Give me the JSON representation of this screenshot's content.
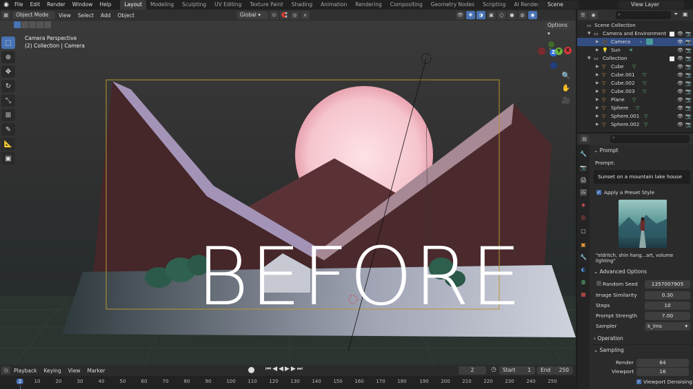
{
  "menubar": {
    "menus": [
      "File",
      "Edit",
      "Render",
      "Window",
      "Help"
    ],
    "workspaces": [
      "Layout",
      "Modeling",
      "Sculpting",
      "UV Editing",
      "Texture Paint",
      "Shading",
      "Animation",
      "Rendering",
      "Compositing",
      "Geometry Nodes",
      "Scripting",
      "AI Render"
    ],
    "active_workspace": "Layout",
    "add_tab": "+",
    "scene": "Scene",
    "view_layer": "View Layer"
  },
  "viewport_header": {
    "mode": "Object Mode",
    "menus": [
      "View",
      "Select",
      "Add",
      "Object"
    ],
    "transform": "Global",
    "options": "Options"
  },
  "viewport": {
    "caption_line1": "Camera Perspective",
    "caption_line2": "(2) Collection | Camera",
    "overlay_text": "BEFORE",
    "gizmo": {
      "z": "Z",
      "y": "Y",
      "x": "X"
    }
  },
  "timeline": {
    "menus": [
      "Playback",
      "Keying",
      "View",
      "Marker"
    ],
    "current_frame": "2",
    "start_label": "Start",
    "start": "1",
    "end_label": "End",
    "end": "250",
    "ticks": [
      "2",
      "10",
      "20",
      "30",
      "40",
      "50",
      "60",
      "70",
      "80",
      "90",
      "100",
      "110",
      "120",
      "130",
      "140",
      "150",
      "160",
      "170",
      "180",
      "190",
      "200",
      "210",
      "220",
      "230",
      "240",
      "250"
    ]
  },
  "outliner": {
    "root": "Scene Collection",
    "items": [
      {
        "label": "Camera and Environment",
        "type": "collection"
      },
      {
        "label": "Camera",
        "type": "camera",
        "selected": true
      },
      {
        "label": "Sun",
        "type": "light"
      },
      {
        "label": "Collection",
        "type": "collection"
      },
      {
        "label": "Cube",
        "type": "mesh"
      },
      {
        "label": "Cube.001",
        "type": "mesh"
      },
      {
        "label": "Cube.002",
        "type": "mesh"
      },
      {
        "label": "Cube.003",
        "type": "mesh"
      },
      {
        "label": "Plane",
        "type": "mesh"
      },
      {
        "label": "Sphere",
        "type": "mesh"
      },
      {
        "label": "Sphere.001",
        "type": "mesh"
      },
      {
        "label": "Sphere.002",
        "type": "mesh"
      }
    ]
  },
  "properties": {
    "prompt_panel": "Prompt",
    "prompt_label": "Prompt:",
    "prompt_value": "Sunset on a mountain lake house",
    "preset_checkbox": "Apply a Preset Style",
    "preset_caption": "\"eldritch, shin hang...art, volume lighting\"",
    "advanced_panel": "Advanced Options",
    "random_seed_label": "Random Seed",
    "random_seed_value": "1357007905",
    "image_similarity_label": "Image Similarity",
    "image_similarity_value": "0.30",
    "steps_label": "Steps",
    "steps_value": "10",
    "prompt_strength_label": "Prompt Strength",
    "prompt_strength_value": "7.00",
    "sampler_label": "Sampler",
    "sampler_value": "k_lms",
    "operation_panel": "Operation",
    "sampling_panel": "Sampling",
    "render_label": "Render",
    "render_value": "64",
    "viewport_label": "Viewport",
    "viewport_value": "16",
    "denoising_label": "Viewport Denoising"
  },
  "colors": {
    "accent": "#4772b3",
    "selection": "#334d80",
    "sun": "#f6cbd3",
    "mountains": "#4a2b2e"
  }
}
